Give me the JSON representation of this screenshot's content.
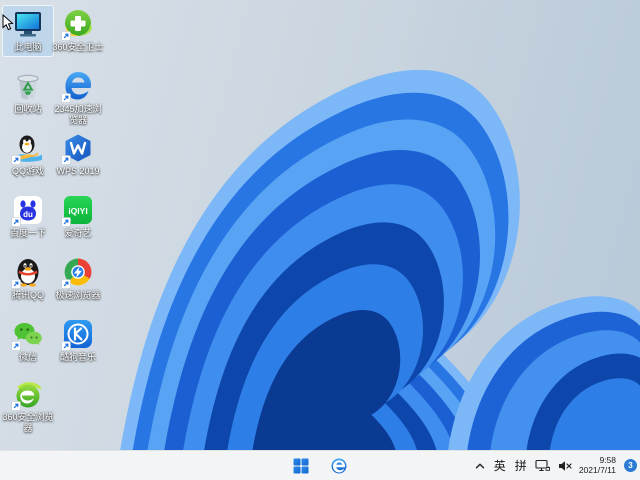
{
  "desktop_icons": [
    {
      "icon": "this-pc",
      "label": "此电脑",
      "selected": true,
      "shortcut_arrow": false,
      "col": 0,
      "row": 0
    },
    {
      "icon": "360-safety",
      "label": "360安全卫士",
      "selected": false,
      "shortcut_arrow": true,
      "col": 1,
      "row": 0
    },
    {
      "icon": "recycle-bin",
      "label": "回收站",
      "selected": false,
      "shortcut_arrow": false,
      "col": 0,
      "row": 1
    },
    {
      "icon": "2345-browser",
      "label": "2345加速浏\n览器",
      "selected": false,
      "shortcut_arrow": true,
      "col": 1,
      "row": 1
    },
    {
      "icon": "qq-games",
      "label": "QQ游戏",
      "selected": false,
      "shortcut_arrow": true,
      "col": 0,
      "row": 2
    },
    {
      "icon": "wps-2019",
      "label": "WPS 2019",
      "selected": false,
      "shortcut_arrow": true,
      "col": 1,
      "row": 2
    },
    {
      "icon": "baidu",
      "label": "百度一下",
      "selected": false,
      "shortcut_arrow": true,
      "col": 0,
      "row": 3
    },
    {
      "icon": "iqiyi",
      "label": "爱奇艺",
      "selected": false,
      "shortcut_arrow": true,
      "col": 1,
      "row": 3
    },
    {
      "icon": "tencent-qq",
      "label": "腾讯QQ",
      "selected": false,
      "shortcut_arrow": true,
      "col": 0,
      "row": 4
    },
    {
      "icon": "speed-browser",
      "label": "极速浏览器",
      "selected": false,
      "shortcut_arrow": true,
      "col": 1,
      "row": 4
    },
    {
      "icon": "wechat",
      "label": "微信",
      "selected": false,
      "shortcut_arrow": true,
      "col": 0,
      "row": 5
    },
    {
      "icon": "kugou-music",
      "label": "酷狗音乐",
      "selected": false,
      "shortcut_arrow": true,
      "col": 1,
      "row": 5
    },
    {
      "icon": "360-browser",
      "label": "360安全浏览\n器",
      "selected": false,
      "shortcut_arrow": true,
      "col": 0,
      "row": 6
    }
  ],
  "taskbar": {
    "tray": {
      "ime_lang": "英",
      "ime_mode": "拼",
      "time": "9:58",
      "date": "2021/7/11",
      "badge_count": "3"
    }
  },
  "colors": {
    "taskbar_bg": "#f3f4f6",
    "badge_blue": "#2b7bd4",
    "bloom_deep_blue": "#0e47ab",
    "bloom_light_blue": "#7cb7f8",
    "desktop_bg": "#c9d4de"
  }
}
